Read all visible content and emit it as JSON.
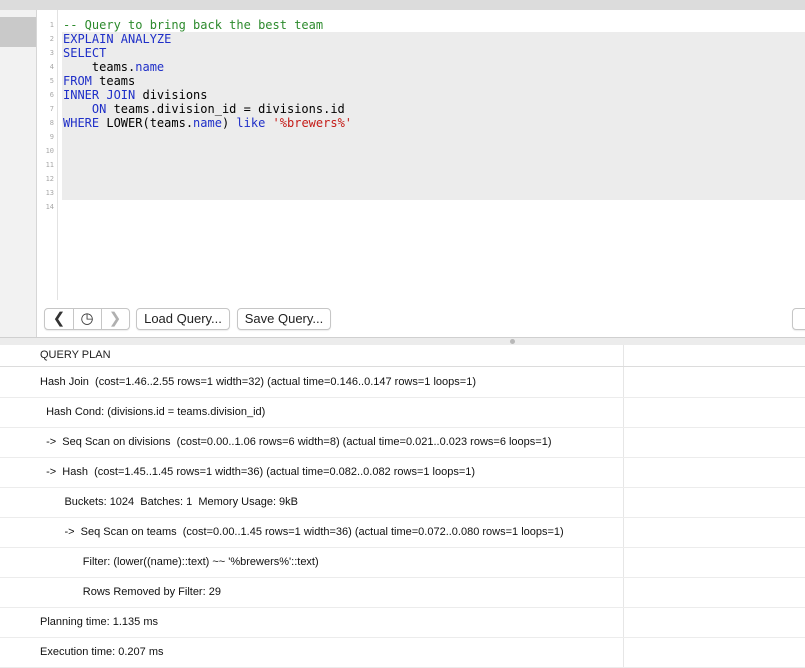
{
  "editor": {
    "line_numbers": [
      "1",
      "2",
      "3",
      "4",
      "5",
      "6",
      "7",
      "8",
      "9",
      "10",
      "11",
      "12",
      "13",
      "14"
    ],
    "code": {
      "l1": "-- Query to bring back the best team",
      "l2": "EXPLAIN ANALYZE",
      "l3": "SELECT",
      "l4_a": "    teams.",
      "l4_b": "name",
      "l5_kw": "FROM",
      "l5_b": " teams",
      "l6_kw": "INNER JOIN",
      "l6_b": " divisions",
      "l7_a": "    ",
      "l7_kw": "ON",
      "l7_b": " teams.division_id = divisions.id",
      "l8_kw": "WHERE",
      "l8_b": " LOWER(teams.",
      "l8_c": "name",
      "l8_d": ") ",
      "l8_e": "like",
      "l8_f": " ",
      "l8_g": "'%brewers%'"
    }
  },
  "toolbar": {
    "back_glyph": "❮",
    "history_glyph": "◷",
    "forward_glyph": "❯",
    "load_label": "Load Query...",
    "save_label": "Save Query..."
  },
  "results": {
    "header": "QUERY PLAN",
    "rows": [
      "Hash Join  (cost=1.46..2.55 rows=1 width=32) (actual time=0.146..0.147 rows=1 loops=1)",
      "  Hash Cond: (divisions.id = teams.division_id)",
      "  ->  Seq Scan on divisions  (cost=0.00..1.06 rows=6 width=8) (actual time=0.021..0.023 rows=6 loops=1)",
      "  ->  Hash  (cost=1.45..1.45 rows=1 width=36) (actual time=0.082..0.082 rows=1 loops=1)",
      "        Buckets: 1024  Batches: 1  Memory Usage: 9kB",
      "        ->  Seq Scan on teams  (cost=0.00..1.45 rows=1 width=36) (actual time=0.072..0.080 rows=1 loops=1)",
      "              Filter: (lower((name)::text) ~~ '%brewers%'::text)",
      "              Rows Removed by Filter: 29",
      "Planning time: 1.135 ms",
      "Execution time: 0.207 ms"
    ]
  }
}
